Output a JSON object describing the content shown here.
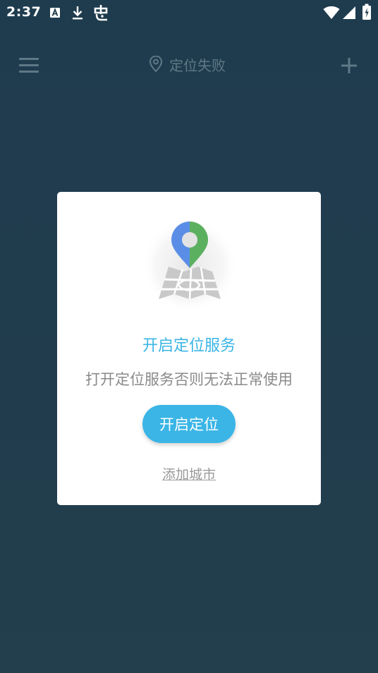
{
  "status_bar": {
    "time": "2:37",
    "icons": [
      "a-notification-icon",
      "download-icon",
      "bug-icon",
      "wifi-icon",
      "signal-icon",
      "battery-charging-icon"
    ]
  },
  "app_bar": {
    "menu_icon": "hamburger-menu-icon",
    "location_icon": "location-pin-icon",
    "title": "定位失败",
    "add_icon": "plus-icon"
  },
  "dialog": {
    "illustration": "map-location-pin-illustration",
    "title": "开启定位服务",
    "subtitle": "打开定位服务否则无法正常使用",
    "enable_button": "开启定位",
    "add_city_link": "添加城市"
  },
  "colors": {
    "background": "#213c4c",
    "accent": "#3ab5e6",
    "muted_icon": "#5e7886",
    "card": "#ffffff",
    "subtitle_text": "#8a8a8a"
  }
}
